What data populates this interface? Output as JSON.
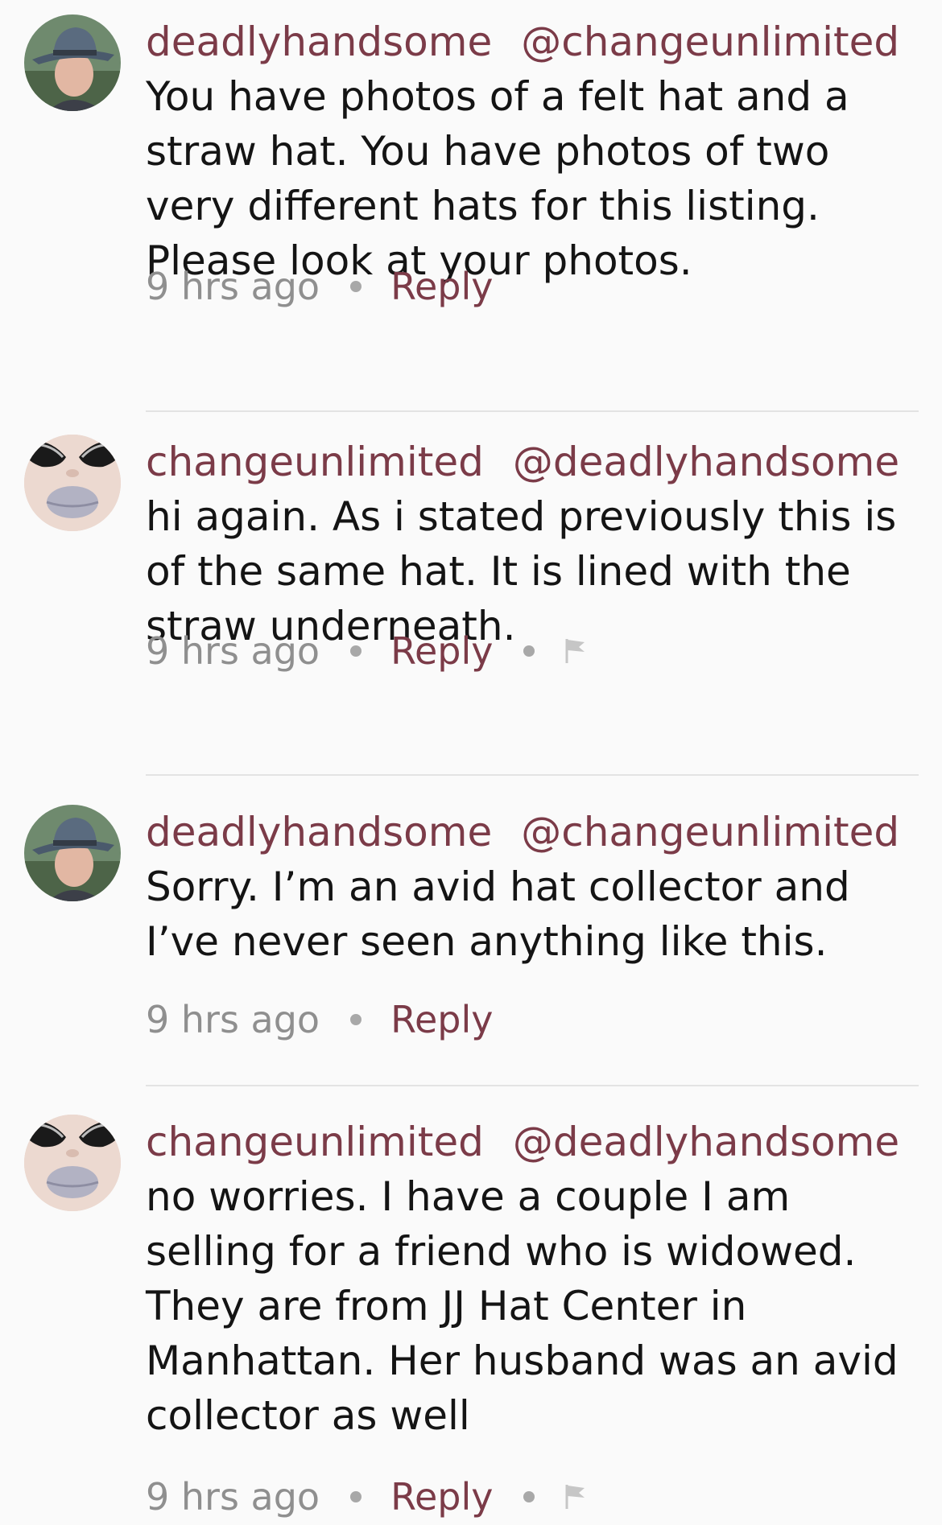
{
  "comments": [
    {
      "author": "deadlyhandsome",
      "mention": "@changeunlimited",
      "avatar_icon": "man-in-fedora-avatar",
      "text": "You have photos of a felt hat and a\nstraw hat. You have photos of two\nvery different hats for this listing.\nPlease look at your photos.",
      "time": "9 hrs ago",
      "reply_label": "Reply",
      "flag": false
    },
    {
      "author": "changeunlimited",
      "mention": "@deadlyhandsome",
      "avatar_icon": "sunglasses-lips-avatar",
      "text": "hi again.  As i stated previously this is\nof the same hat.  It is lined with the\nstraw underneath.",
      "time": "9 hrs ago",
      "reply_label": "Reply",
      "flag": true
    },
    {
      "author": "deadlyhandsome",
      "mention": "@changeunlimited",
      "avatar_icon": "man-in-fedora-avatar",
      "text": "Sorry. I’m an avid hat collector and\nI’ve never seen anything like this.",
      "time": "9 hrs ago",
      "reply_label": "Reply",
      "flag": false
    },
    {
      "author": "changeunlimited",
      "mention": "@deadlyhandsome",
      "avatar_icon": "sunglasses-lips-avatar",
      "text": "no worries.  I have a couple I am\nselling for a friend who is widowed.\nThey are from JJ Hat Center in\nManhattan.  Her husband was an avid\ncollector as well",
      "time": "9 hrs ago",
      "reply_label": "Reply",
      "flag": true
    }
  ],
  "colors": {
    "username": "#7b3b48",
    "body_text": "#141414",
    "timestamp": "#8f8f8f",
    "divider": "#e3e3e3",
    "background": "#fafafa"
  }
}
